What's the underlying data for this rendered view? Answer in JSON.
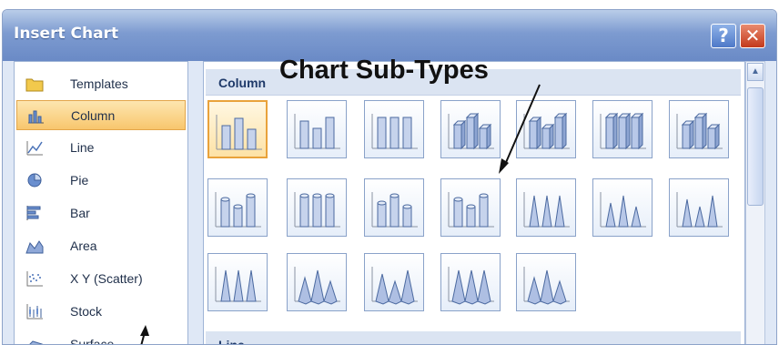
{
  "window": {
    "title": "Insert Chart",
    "help_label": "?",
    "close_label": "✕"
  },
  "sidebar": {
    "items": [
      {
        "label": "Templates",
        "icon": "folder-icon"
      },
      {
        "label": "Column",
        "icon": "column-chart-icon",
        "selected": true
      },
      {
        "label": "Line",
        "icon": "line-chart-icon"
      },
      {
        "label": "Pie",
        "icon": "pie-chart-icon"
      },
      {
        "label": "Bar",
        "icon": "bar-chart-icon"
      },
      {
        "label": "Area",
        "icon": "area-chart-icon"
      },
      {
        "label": "X Y (Scatter)",
        "icon": "scatter-chart-icon"
      },
      {
        "label": "Stock",
        "icon": "stock-chart-icon"
      },
      {
        "label": "Surface",
        "icon": "surface-chart-icon"
      }
    ]
  },
  "gallery": {
    "sections": [
      {
        "label": "Column",
        "subtype_count": 19
      },
      {
        "label": "Line"
      }
    ],
    "selected_subtype": 1
  },
  "annotation": {
    "text": "Chart Sub-Types"
  },
  "colors": {
    "title_bar": "#7d9bd0",
    "selection": "#f8c66d",
    "close": "#c3391b"
  }
}
